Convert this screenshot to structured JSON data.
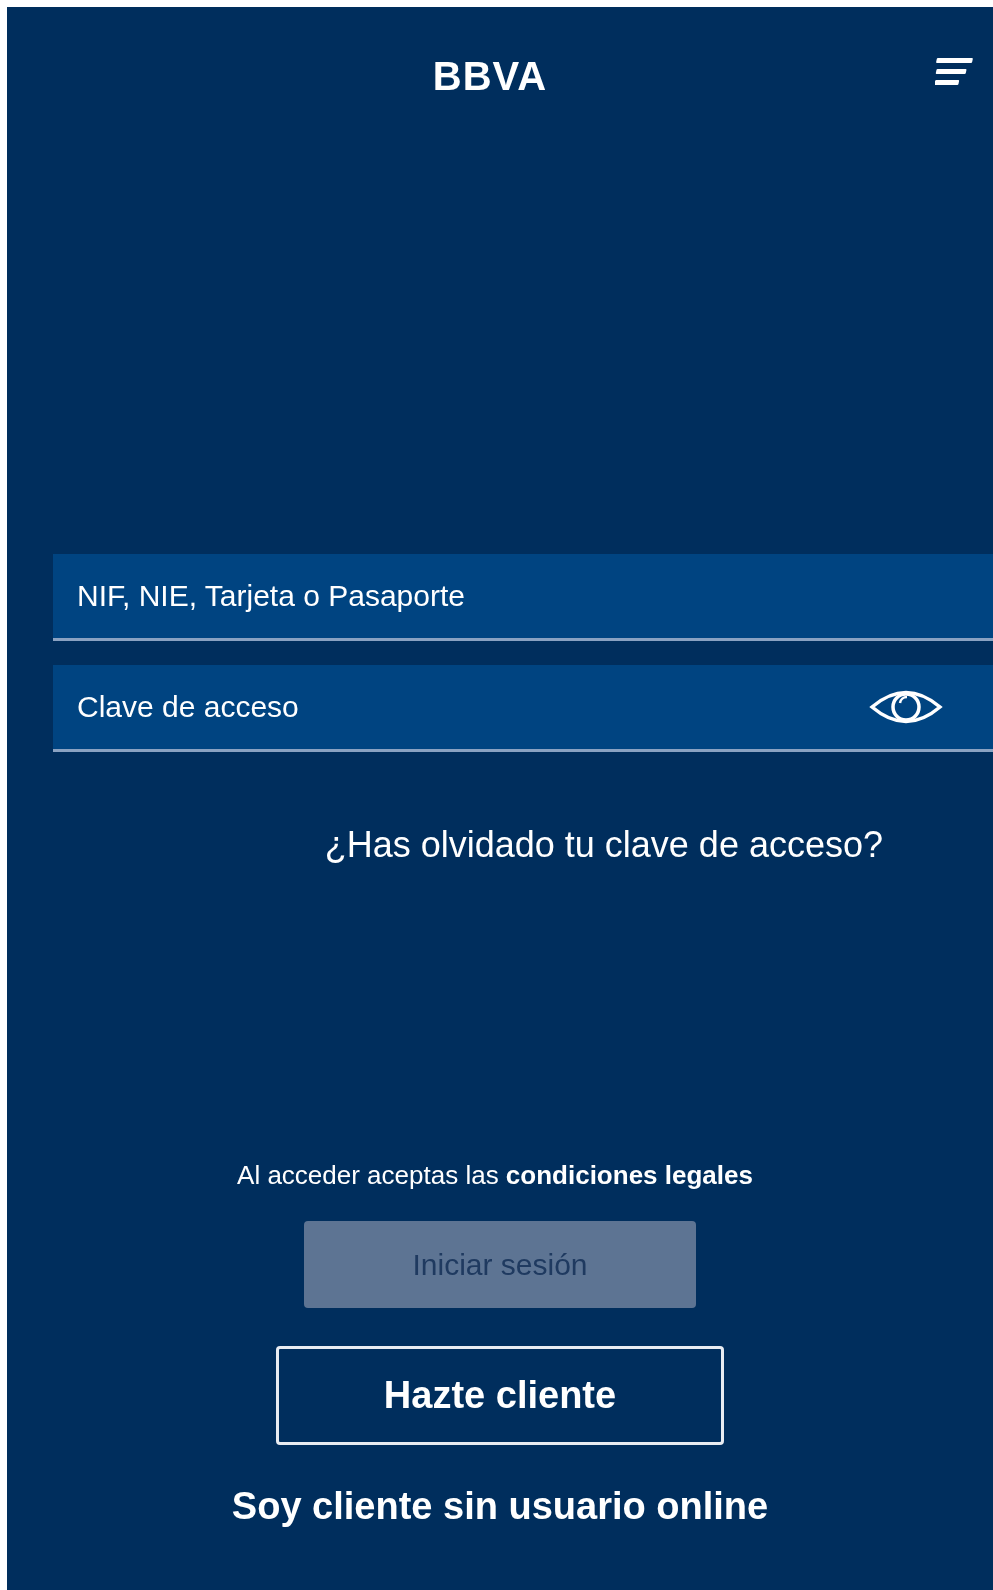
{
  "header": {
    "logo": "BBVA"
  },
  "fields": [
    {
      "placeholder": "NIF, NIE, Tarjeta o Pasaporte",
      "reveal": false
    },
    {
      "placeholder": "Clave de acceso",
      "reveal": true
    }
  ],
  "forgot_link": "¿Has olvidado tu clave de acceso?",
  "legal_notice": "Al acceder aceptas las **condiciones legales**",
  "login_button": {
    "label": "Iniciar sesión",
    "disabled": true
  },
  "signup_button": {
    "label": "Hazte cliente"
  },
  "no_user_link": "Soy cliente sin usuario online"
}
